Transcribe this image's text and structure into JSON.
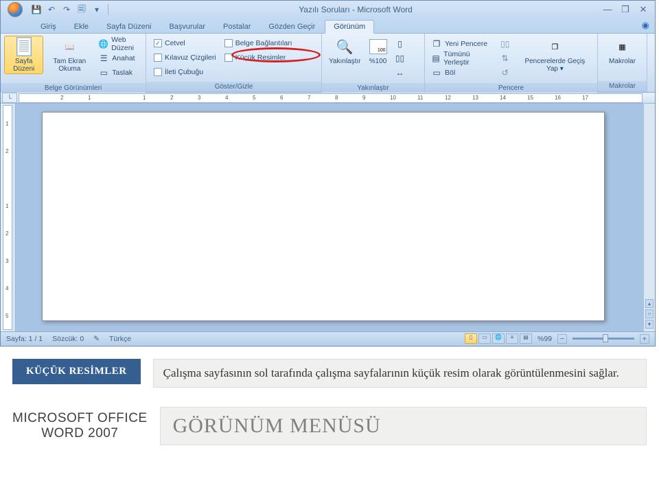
{
  "window": {
    "title": "Yazılı Soruları - Microsoft Word"
  },
  "qat": {
    "save": "💾",
    "undo": "↶",
    "redo": "↷",
    "print": "🗐",
    "more": "▾"
  },
  "tabs": {
    "items": [
      "Giriş",
      "Ekle",
      "Sayfa Düzeni",
      "Başvurular",
      "Postalar",
      "Gözden Geçir",
      "Görünüm"
    ],
    "active_index": 6
  },
  "ribbon": {
    "group1": {
      "label": "Belge Görünümleri",
      "print_layout": "Sayfa Düzeni",
      "full_screen": "Tam Ekran Okuma",
      "web_layout": "Web Düzeni",
      "outline": "Anahat",
      "draft": "Taslak"
    },
    "group2": {
      "label": "Göster/Gizle",
      "ruler": "Cetvel",
      "gridlines": "Kılavuz Çizgileri",
      "message_bar": "İleti Çubuğu",
      "doc_map": "Belge Bağlantıları",
      "thumbnails": "Küçük Resimler"
    },
    "group3": {
      "label": "Yakınlaştır",
      "zoom": "Yakınlaştır",
      "hundred": "%100"
    },
    "group4": {
      "label": "Pencere",
      "new_window": "Yeni Pencere",
      "arrange_all": "Tümünü Yerleştir",
      "split": "Böl",
      "switch_windows": "Pencerelerde Geçiş Yap ▾"
    },
    "group5": {
      "label": "Makrolar",
      "macros": "Makrolar"
    }
  },
  "status": {
    "page": "Sayfa: 1 / 1",
    "words": "Sözcük: 0",
    "language": "Türkçe",
    "zoom_pct": "%99",
    "minus": "−",
    "plus": "+"
  },
  "slide": {
    "badge": "KÜÇÜK RESİMLER",
    "description": "Çalışma sayfasının sol tarafında çalışma sayfalarının küçük resim olarak görüntülenmesini sağlar.",
    "brand_line1": "MICROSOFT OFFICE",
    "brand_line2": "WORD 2007",
    "title": "GÖRÜNÜM MENÜSÜ"
  },
  "icons": {
    "book": "📖",
    "globe": "🌐",
    "list": "☰",
    "page": "▭",
    "magnifier": "🔍",
    "pages": "▭",
    "windows": "❐",
    "macro": "▦",
    "check": "✓",
    "proof": "✎"
  }
}
